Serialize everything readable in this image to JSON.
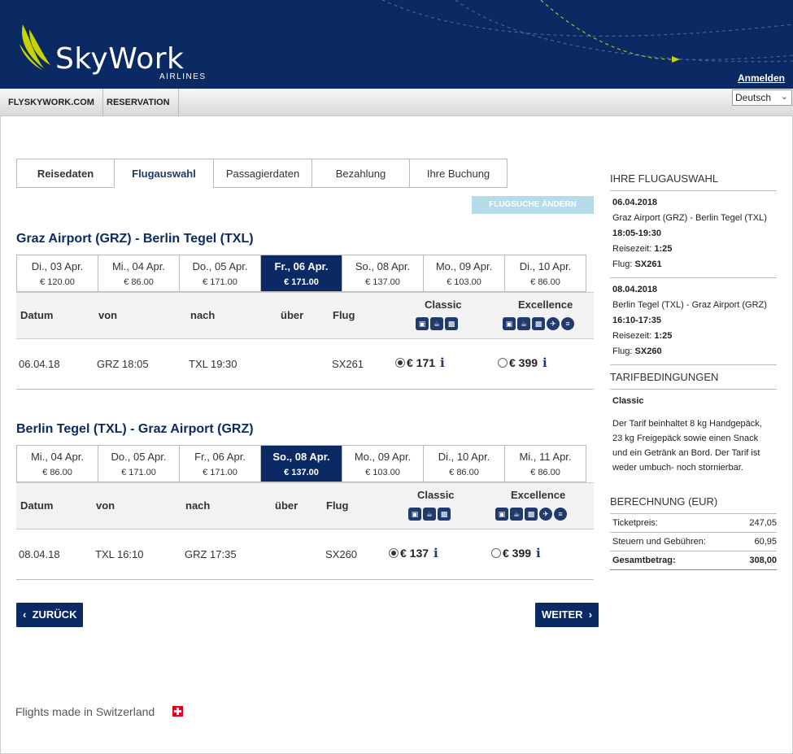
{
  "header": {
    "brand": "SkyWork",
    "brand_sub": "AIRLINES",
    "login": "Anmelden",
    "accent": "#c8d400"
  },
  "nav": {
    "items": [
      "FLYSKYWORK.COM",
      "RESERVATION"
    ],
    "language": "Deutsch"
  },
  "steps": [
    "Reisedaten",
    "Flugauswahl",
    "Passagierdaten",
    "Bezahlung",
    "Ihre Buchung"
  ],
  "change_search": "FLUGSUCHE ÄNDERN",
  "outbound": {
    "title": "Graz Airport (GRZ) - Berlin Tegel (TXL)",
    "dates": [
      {
        "day": "Di., 03 Apr.",
        "price": "€ 120.00"
      },
      {
        "day": "Mi., 04 Apr.",
        "price": "€ 86.00"
      },
      {
        "day": "Do., 05 Apr.",
        "price": "€ 171.00"
      },
      {
        "day": "Fr., 06 Apr.",
        "price": "€ 171.00"
      },
      {
        "day": "So., 08 Apr.",
        "price": "€ 137.00"
      },
      {
        "day": "Mo., 09 Apr.",
        "price": "€ 103.00"
      },
      {
        "day": "Di., 10 Apr.",
        "price": "€ 86.00"
      }
    ],
    "headers": {
      "date": "Datum",
      "from": "von",
      "to": "nach",
      "via": "über",
      "flight": "Flug",
      "classic": "Classic",
      "excellence": "Excellence"
    },
    "row": {
      "date": "06.04.18",
      "from": "GRZ 18:05",
      "to": "TXL 19:30",
      "via": "",
      "flight": "SX261",
      "classic": "€ 171",
      "excellence": "€ 399",
      "info": "i"
    }
  },
  "inbound": {
    "title": "Berlin Tegel (TXL) - Graz Airport (GRZ)",
    "dates": [
      {
        "day": "Mi., 04 Apr.",
        "price": "€ 86.00"
      },
      {
        "day": "Do., 05 Apr.",
        "price": "€ 171.00"
      },
      {
        "day": "Fr., 06 Apr.",
        "price": "€ 171.00"
      },
      {
        "day": "So., 08 Apr.",
        "price": "€ 137.00"
      },
      {
        "day": "Mo., 09 Apr.",
        "price": "€ 103.00"
      },
      {
        "day": "Di., 10 Apr.",
        "price": "€ 86.00"
      },
      {
        "day": "Mi., 11 Apr.",
        "price": "€ 86.00"
      }
    ],
    "headers": {
      "date": "Datum",
      "from": "von",
      "to": "nach",
      "via": "über",
      "flight": "Flug",
      "classic": "Classic",
      "excellence": "Excellence"
    },
    "row": {
      "date": "08.04.18",
      "from": "TXL 16:10",
      "to": "GRZ 17:35",
      "via": "",
      "flight": "SX260",
      "classic": "€ 137",
      "excellence": "€ 399",
      "info": "i"
    }
  },
  "buttons": {
    "back": "ZURÜCK",
    "next": "WEITER"
  },
  "footer": "Flights made in Switzerland",
  "sidebar": {
    "selection_title": "IHRE FLUGAUSWAHL",
    "legs": [
      {
        "date": "06.04.2018",
        "route": "Graz Airport (GRZ) - Berlin Tegel (TXL)",
        "time": "18:05-19:30",
        "duration_label": "Reisezeit:",
        "duration": "1:25",
        "flight_label": "Flug:",
        "flight": "SX261"
      },
      {
        "date": "08.04.2018",
        "route": "Berlin Tegel (TXL) - Graz Airport (GRZ)",
        "time": "16:10-17:35",
        "duration_label": "Reisezeit:",
        "duration": "1:25",
        "flight_label": "Flug:",
        "flight": "SX260"
      }
    ],
    "tariff_title": "TARIFBEDINGUNGEN",
    "tariff_name": "Classic",
    "tariff_text": "Der Tarif beinhaltet 8 kg Handgepäck, 23 kg Freigepäck sowie einen Snack und ein Getränk an Bord. Der Tarif ist weder umbuch- noch stornierbar.",
    "calc_title": "BERECHNUNG (EUR)",
    "calc": [
      {
        "label": "Ticketpreis:",
        "value": "247,05"
      },
      {
        "label": "Steuern und Gebühren:",
        "value": "60,95"
      },
      {
        "label": "Gesamtbetrag:",
        "value": "308,00"
      }
    ]
  }
}
